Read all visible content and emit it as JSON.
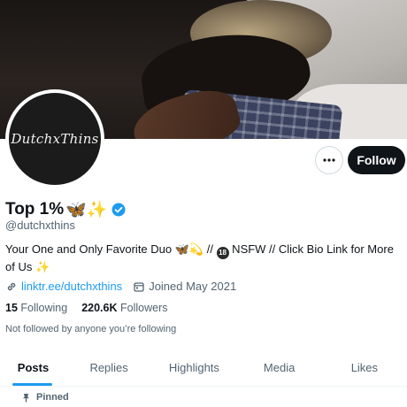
{
  "profile": {
    "display_name": "Top 1%",
    "name_emojis": "🦋✨",
    "handle": "@dutchxthins",
    "avatar_text": "DutchxThins",
    "bio_part1": "Your One and Only Favorite Duo 🦋💫 // ",
    "bio_badge": "18",
    "bio_part2": " NSFW // Click Bio Link for More of Us ✨",
    "link": "linktr.ee/dutchxthins",
    "joined": "Joined May 2021",
    "following_count": "15",
    "following_label": "Following",
    "followers_count": "220.6K",
    "followers_label": "Followers",
    "not_followed": "Not followed by anyone you’re following"
  },
  "actions": {
    "follow_label": "Follow"
  },
  "tabs": [
    {
      "label": "Posts",
      "active": true
    },
    {
      "label": "Replies"
    },
    {
      "label": "Highlights"
    },
    {
      "label": "Media"
    },
    {
      "label": "Likes"
    }
  ],
  "pinned_label": "Pinned",
  "colors": {
    "accent": "#1d9bf0",
    "text": "#0f1419",
    "secondary": "#536471",
    "follow_bg": "#0f1419"
  }
}
